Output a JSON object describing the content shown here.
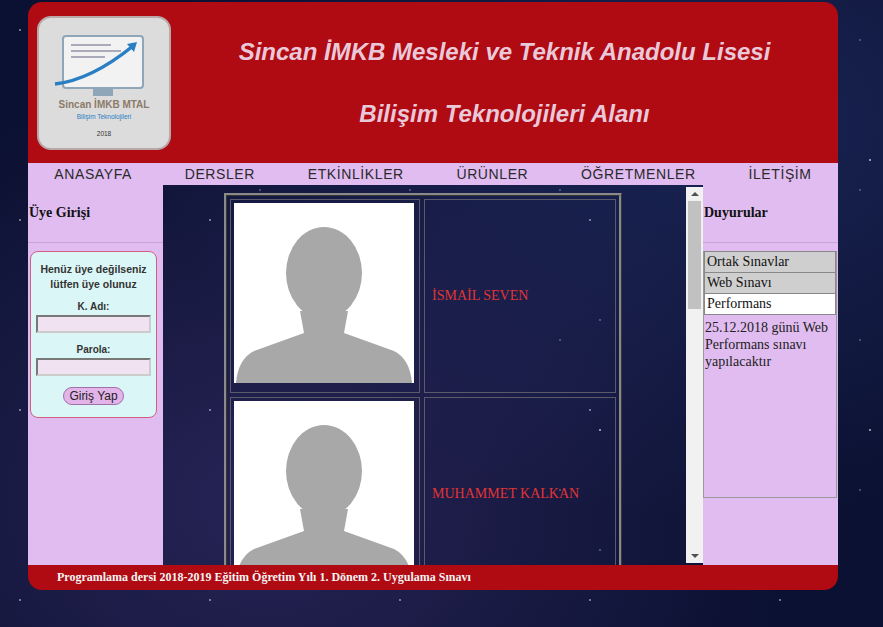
{
  "header": {
    "logo": {
      "name": "Sincan İMKB MTAL",
      "subtitle": "Bilişim Teknolojileri",
      "year": "2018"
    },
    "title": "Sincan İMKB Mesleki ve Teknik Anadolu Lisesi",
    "subtitle": "Bilişim Teknolojileri Alanı"
  },
  "nav": [
    {
      "label": "ANASAYFA"
    },
    {
      "label": "DERSLER"
    },
    {
      "label": "ETKİNLİKLER"
    },
    {
      "label": "ÜRÜNLER"
    },
    {
      "label": "ÖĞRETMENLER"
    },
    {
      "label": "İLETİŞİM"
    }
  ],
  "login": {
    "title": "Üye Girişi",
    "prompt": "Henüz üye değilseniz lütfen üye olunuz",
    "username_label": "K. Adı:",
    "username": "",
    "password_label": "Parola:",
    "password": "",
    "button": "Giriş Yap"
  },
  "teachers": [
    {
      "name": "İSMAİL SEVEN"
    },
    {
      "name": "MUHAMMET KALKAN"
    }
  ],
  "scrollbar": {
    "position": 0,
    "visible_share": 0.31
  },
  "announcements": {
    "title": "Duyurular",
    "tabs": [
      {
        "label": "Ortak Sınavlar",
        "selected": false
      },
      {
        "label": "Web Sınavı",
        "selected": false
      },
      {
        "label": "Performans",
        "selected": true
      }
    ],
    "content": "25.12.2018 günü Web Performans sınavı yapılacaktır"
  },
  "ticker": "Programlama dersi 2018-2019 Eğitim Öğretim Yılı 1. Dönem 2. Uygulama Sınavı"
}
